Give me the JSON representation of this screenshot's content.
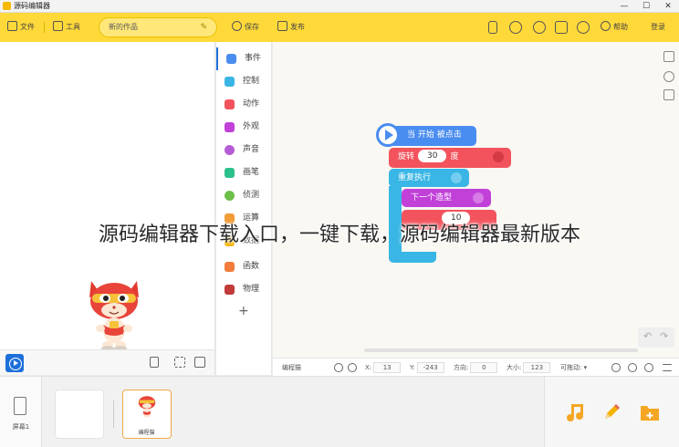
{
  "window": {
    "title": "源码编辑器",
    "minimize": "—",
    "restore": "☐",
    "close": "✕"
  },
  "toolbar": {
    "file": "文件",
    "tools": "工具",
    "project_name": "新的作品",
    "save": "保存",
    "publish": "发布",
    "help": "帮助",
    "login": "登录"
  },
  "categories": [
    {
      "label": "事件",
      "color": "#4a8df0"
    },
    {
      "label": "控制",
      "color": "#39b6e5"
    },
    {
      "label": "动作",
      "color": "#f2535c"
    },
    {
      "label": "外观",
      "color": "#c040d8"
    },
    {
      "label": "声音",
      "color": "#b65bd6"
    },
    {
      "label": "画笔",
      "color": "#2cc08a"
    },
    {
      "label": "侦测",
      "color": "#6cc04a"
    },
    {
      "label": "运算",
      "color": "#f29c38"
    },
    {
      "label": "数据",
      "color": "#f5b300"
    },
    {
      "label": "函数",
      "color": "#f27c3a"
    },
    {
      "label": "物理",
      "color": "#c23a3a"
    }
  ],
  "add_category": "+",
  "blocks": {
    "when_clicked": "当 开始 被点击",
    "rotate": "旋转",
    "rotate_value": "30",
    "rotate_unit": "度",
    "repeat": "重复执行",
    "next_costume": "下一个造型",
    "wait_value": "10"
  },
  "infobar": {
    "sprite_name": "编程猫",
    "x_label": "X:",
    "x_value": "13",
    "y_label": "Y:",
    "y_value": "-243",
    "dir_label": "方向:",
    "dir_value": "0",
    "size_label": "大小:",
    "size_value": "123",
    "drag_label": "可拖动:"
  },
  "bottom": {
    "screen_label": "屏幕1",
    "sprite_label": "编程猫"
  },
  "caption": "源码编辑器下载入口，一键下载，源码编辑器最新版本",
  "colors": {
    "toolbar": "#ffd93a",
    "accent": "#1e6fd9",
    "event_block": "#4a8df0",
    "motion_block": "#f2535c",
    "control_block": "#39b6e5",
    "looks_block": "#c040d8"
  }
}
